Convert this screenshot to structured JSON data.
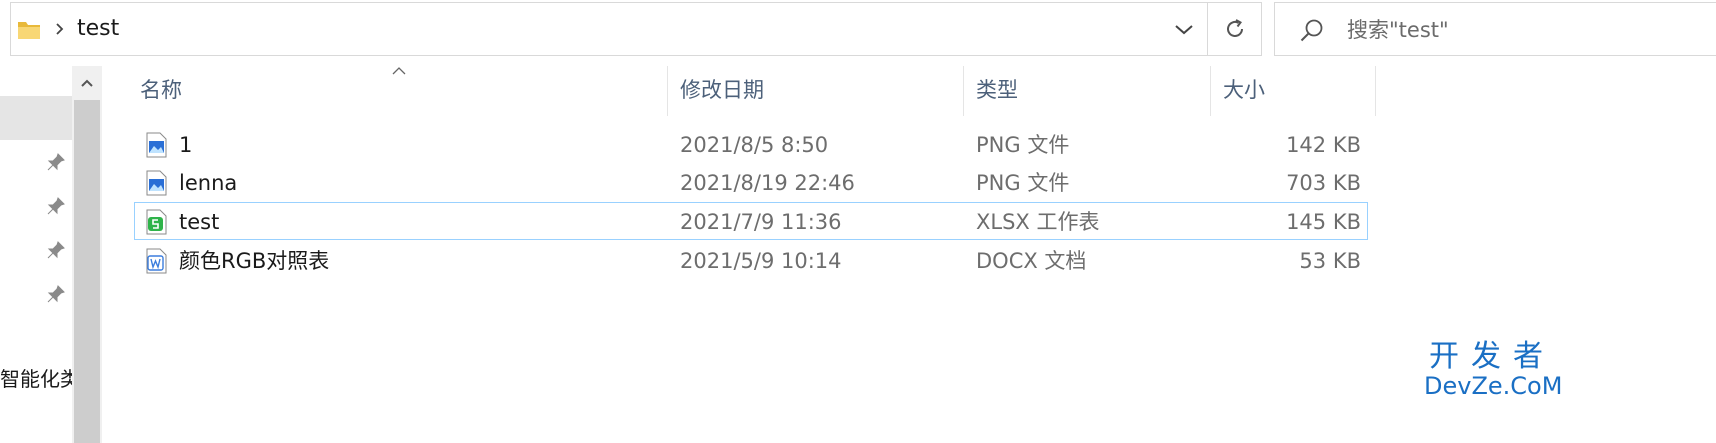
{
  "address_bar": {
    "folder_icon": "folder-icon",
    "separator_icon": "chevron-right-icon",
    "breadcrumb": [
      "test"
    ],
    "dropdown_icon": "chevron-down-icon",
    "refresh_icon": "refresh-icon"
  },
  "search": {
    "icon": "search-icon",
    "placeholder": "搜索\"test\"",
    "value": ""
  },
  "nav_pane": {
    "pin_icon": "pin-icon",
    "pinned_count": 4,
    "visible_label": "智能化类"
  },
  "columns": {
    "name": "名称",
    "date": "修改日期",
    "type": "类型",
    "size": "大小",
    "sorted_by": "名称",
    "sort_direction": "ascending"
  },
  "files": [
    {
      "name": "1",
      "date": "2021/8/5 8:50",
      "type": "PNG 文件",
      "size": "142 KB",
      "icon": "image-file-icon",
      "selected": false
    },
    {
      "name": "lenna",
      "date": "2021/8/19 22:46",
      "type": "PNG 文件",
      "size": "703 KB",
      "icon": "image-file-icon",
      "selected": false
    },
    {
      "name": "test",
      "date": "2021/7/9 11:36",
      "type": "XLSX 工作表",
      "size": "145 KB",
      "icon": "spreadsheet-file-icon",
      "selected": true
    },
    {
      "name": "颜色RGB对照表",
      "date": "2021/5/9 10:14",
      "type": "DOCX 文档",
      "size": "53 KB",
      "icon": "word-document-icon",
      "selected": false
    }
  ],
  "watermark": {
    "line1": "开发者",
    "line2": "DevZe.CoM"
  },
  "colors": {
    "selection_border": "#99d1ff",
    "header_text": "#4c607a",
    "folder_yellow": "#f8d775",
    "watermark": "#1a6fc4"
  }
}
